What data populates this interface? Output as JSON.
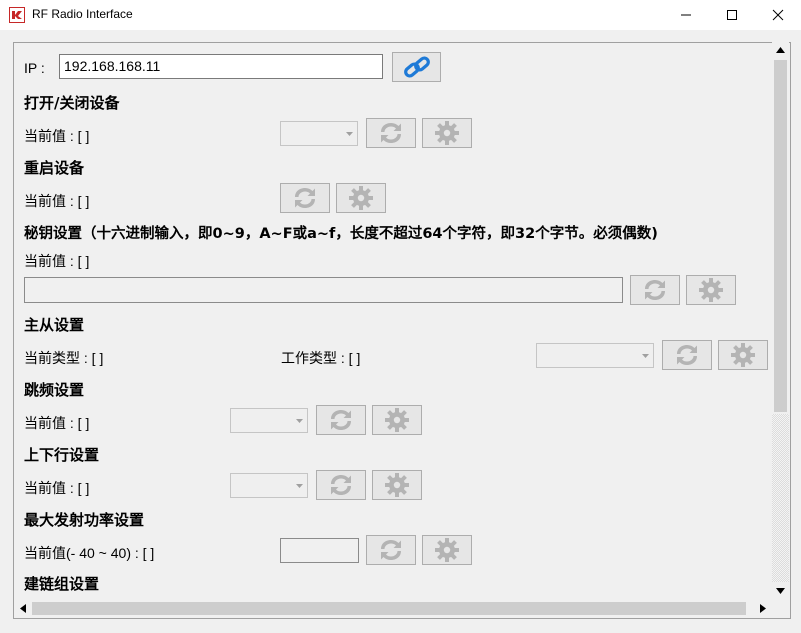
{
  "window": {
    "title": "RF Radio Interface"
  },
  "ip": {
    "label": "IP :",
    "value": "192.168.168.11"
  },
  "sections": {
    "power": {
      "title": "打开/关闭设备",
      "current": "当前值 : [    ]"
    },
    "reboot": {
      "title": "重启设备",
      "current": "当前值 : [    ]"
    },
    "key": {
      "title": "秘钥设置（十六进制输入，即0~9，A~F或a~f，长度不超过64个字符，即32个字节。必须偶数)",
      "current": "当前值 : [    ]"
    },
    "master": {
      "title": "主从设置",
      "current_type": "当前类型 : [    ]",
      "work_type": "工作类型 : [    ]"
    },
    "hopping": {
      "title": "跳频设置",
      "current": "当前值 : [    ]"
    },
    "updown": {
      "title": "上下行设置",
      "current": "当前值 : [    ]"
    },
    "txpower": {
      "title": "最大发射功率设置",
      "current": "当前值(- 40 ~ 40) : [    ]"
    },
    "link": {
      "title": "建链组设置"
    }
  },
  "colors": {
    "icon_gray": "#b4b4b4",
    "link_blue": "#1e7ad7",
    "app_icon_red": "#c62828"
  },
  "icons": {
    "connect": "link-icon",
    "refresh": "refresh-icon",
    "settings": "gear-icon"
  }
}
